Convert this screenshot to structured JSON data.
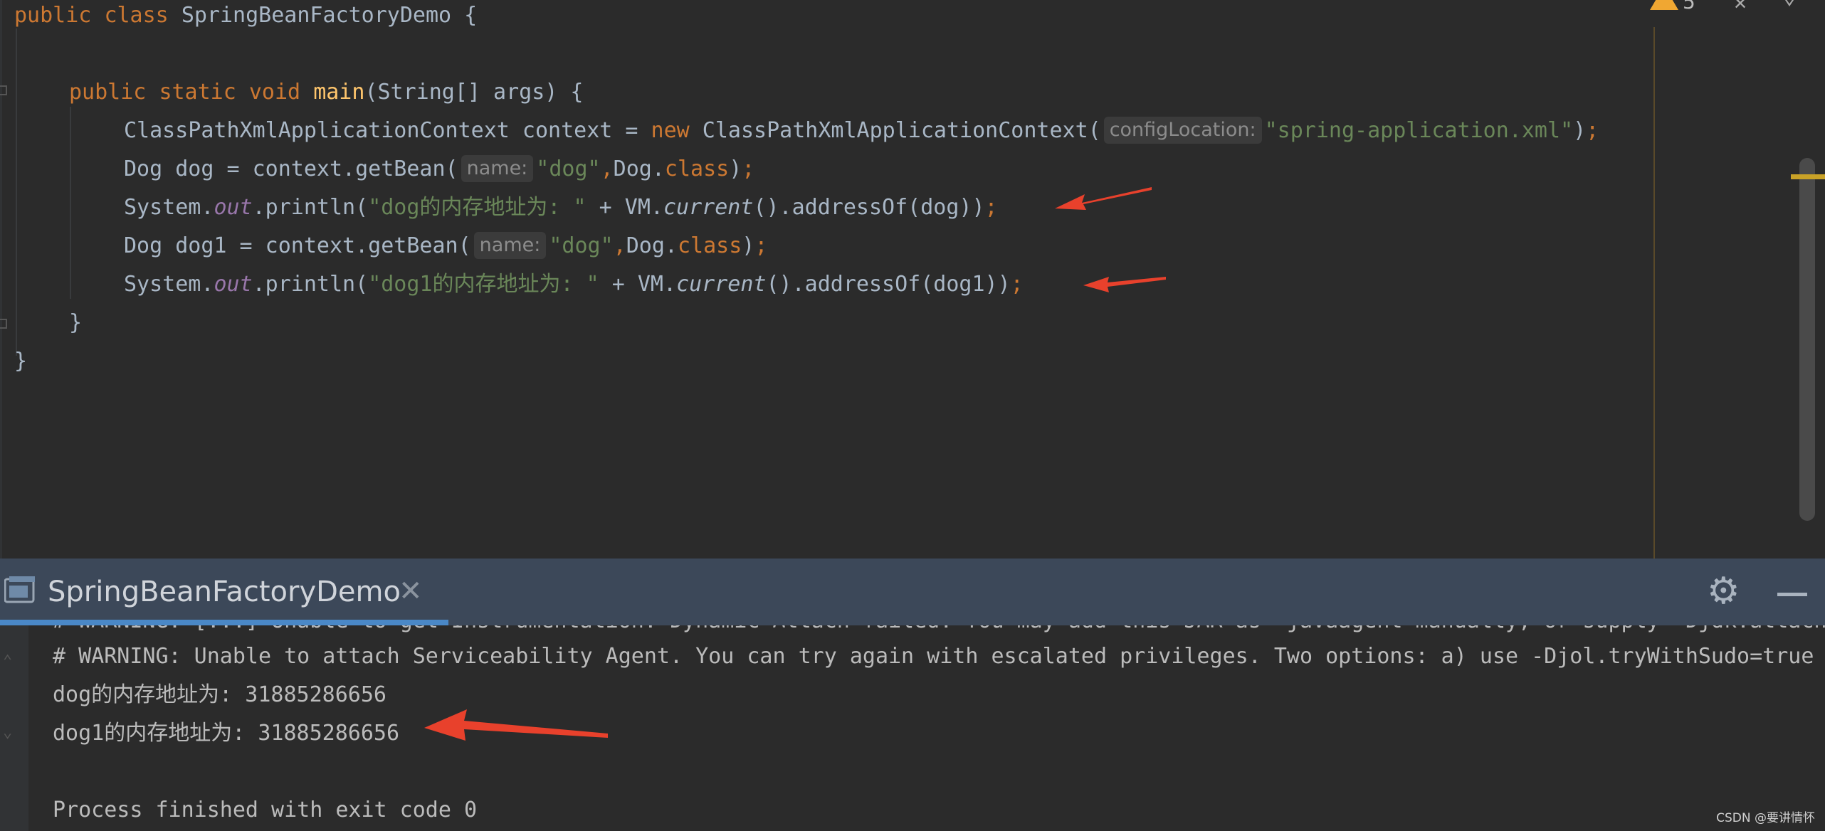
{
  "editor": {
    "lines": {
      "l1": {
        "kw1": "public",
        "kw2": "class",
        "name": "SpringBeanFactoryDemo",
        "tail": " {"
      },
      "l3": {
        "kw1": "public",
        "kw2": "static",
        "kw3": "void",
        "fn": "main",
        "tail": "(String[] args) {"
      },
      "l4": {
        "pre": "ClassPathXmlApplicationContext context = ",
        "kw": "new",
        "mid": " ClassPathXmlApplicationContext(",
        "hint": "configLocation:",
        "str": "\"spring-application.xml\"",
        "post": ")",
        "semi": ";"
      },
      "l5": {
        "pre": "Dog dog = context.getBean(",
        "hint": "name:",
        "str": "\"dog\"",
        "comma": ",",
        "cls": "Dog.",
        "kw": "class",
        "post": ")",
        "semi": ";"
      },
      "l6": {
        "pre": "System.",
        "fld": "out",
        "mid": ".println(",
        "str": "\"dog的内存地址为: \"",
        "mid2": " + VM.",
        "it": "current",
        "post": "().addressOf(dog))",
        "semi": ";"
      },
      "l7": {
        "pre": "Dog dog1 = context.getBean(",
        "hint": "name:",
        "str": "\"dog\"",
        "comma": ",",
        "cls": "Dog.",
        "kw": "class",
        "post": ")",
        "semi": ";"
      },
      "l8": {
        "pre": "System.",
        "fld": "out",
        "mid": ".println(",
        "str": "\"dog1的内存地址为: \"",
        "mid2": " + VM.",
        "it": "current",
        "post": "().addressOf(dog1))",
        "semi": ";"
      },
      "l9": {
        "text": "}"
      },
      "l10": {
        "text": "}"
      }
    },
    "warning_count": "5"
  },
  "run_panel": {
    "tab_title": "SpringBeanFactoryDemo",
    "close_glyph": "✕",
    "console": {
      "cutoff_line": "# WARNING: [...] Unable to get Instrumentation. Dynamic Attach failed. You may add this JAR as -javaagent manually, or supply -Djdk.attach.allowAttachSelf",
      "lines": [
        "# WARNING: Unable to attach Serviceability Agent. You can try again with escalated privileges. Two options: a) use -Djol.tryWithSudo=true",
        "dog的内存地址为: 31885286656",
        "dog1的内存地址为: 31885286656",
        "",
        "Process finished with exit code 0"
      ]
    }
  },
  "watermark": "CSDN @要讲情怀",
  "colors": {
    "keyword": "#cc7832",
    "string": "#6a8759",
    "field": "#9876aa",
    "method_decl": "#ffc66d",
    "arrow": "#e8412c"
  }
}
